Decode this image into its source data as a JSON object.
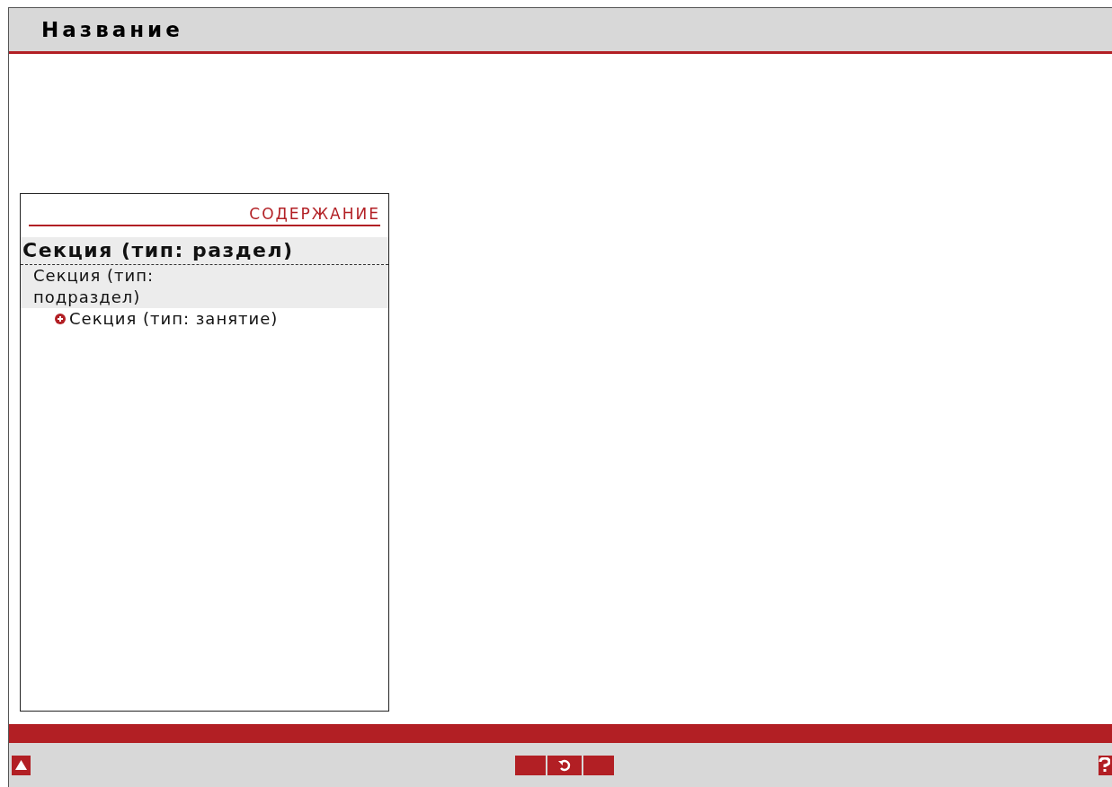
{
  "header": {
    "title": "Название"
  },
  "toc": {
    "title": "СОДЕРЖАНИЕ",
    "items": [
      {
        "label": "Секция (тип: раздел)",
        "selected": true,
        "expanded": true,
        "children": [
          {
            "label": "Секция (тип: подраздел)",
            "selected": false,
            "expanded": true,
            "children": [
              {
                "label": "Секция (тип: занятие)",
                "selected": false,
                "expanded": false
              }
            ]
          }
        ]
      }
    ]
  }
}
